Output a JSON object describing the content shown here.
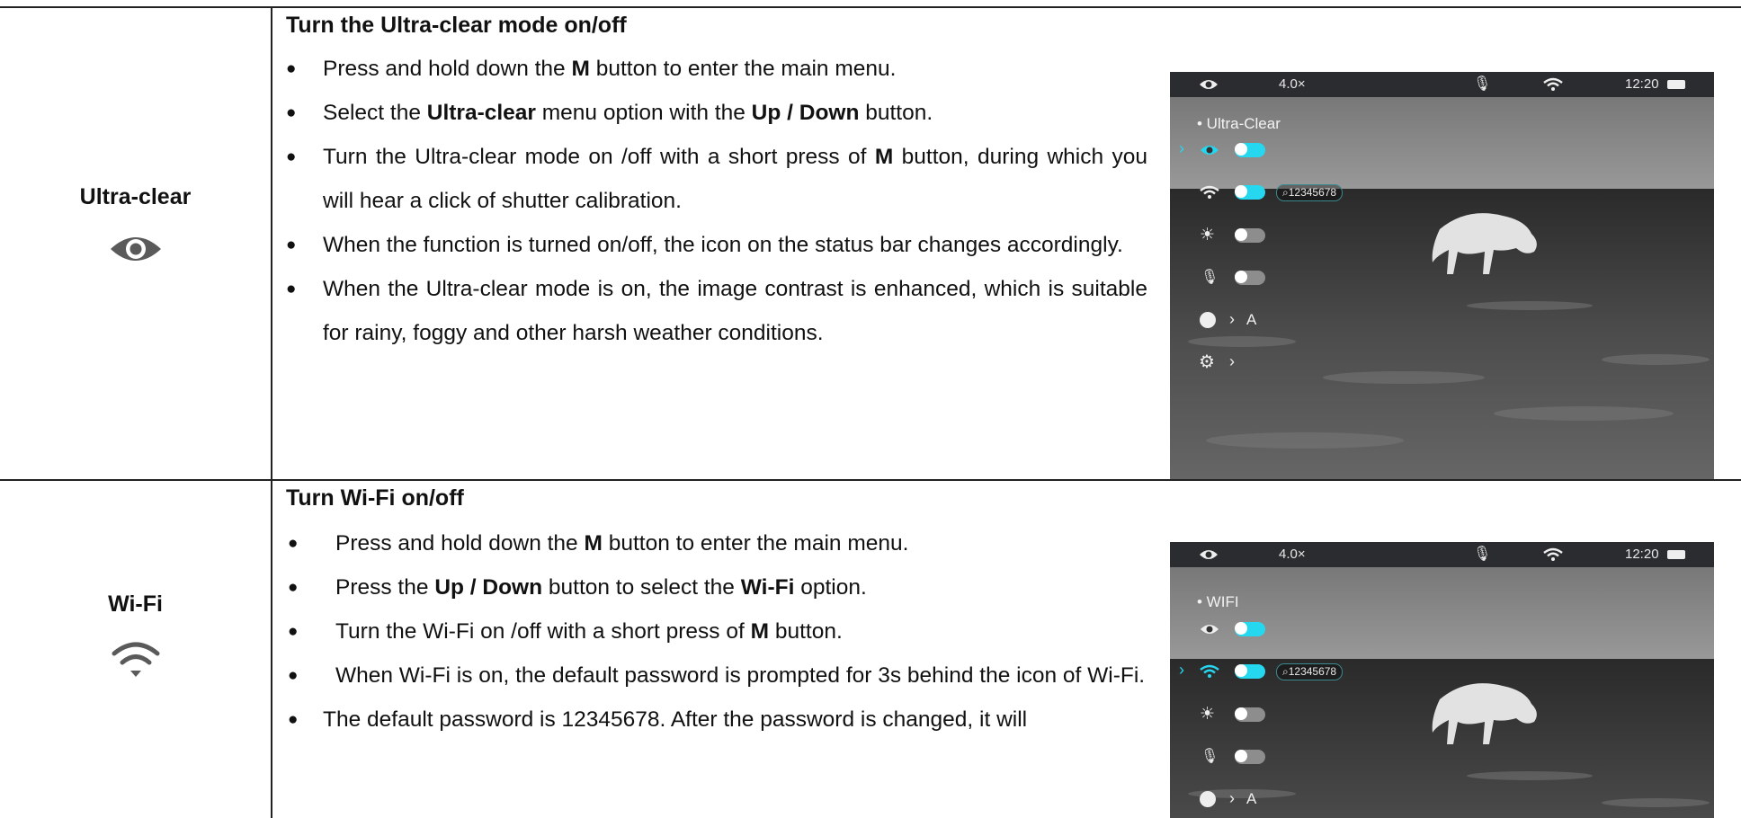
{
  "sections": [
    {
      "label": "Ultra-clear",
      "icon": "eye-icon",
      "heading": "Turn the Ultra-clear mode on/off",
      "bullets": [
        {
          "parts": [
            [
              "Press and hold down the ",
              false
            ],
            [
              "M",
              true
            ],
            [
              " button to enter the main menu.",
              false
            ]
          ]
        },
        {
          "parts": [
            [
              "Select the ",
              false
            ],
            [
              "Ultra-clear",
              true
            ],
            [
              " menu option with the ",
              false
            ],
            [
              "Up / Down",
              true
            ],
            [
              " button.",
              false
            ]
          ]
        },
        {
          "parts": [
            [
              "Turn the Ultra-clear mode on /off with a short press of ",
              false
            ],
            [
              "M",
              true
            ],
            [
              " button, during which you will hear a click of shutter calibration.",
              false
            ]
          ]
        },
        {
          "parts": [
            [
              "When the function is turned on/off, the icon on the status bar changes accordingly.",
              false
            ]
          ]
        },
        {
          "parts": [
            [
              "When the Ultra-clear mode is on, the image contrast is enhanced, which is suitable for rainy, foggy and other harsh weather conditions.",
              false
            ]
          ]
        }
      ],
      "screen": {
        "menu_title": "• Ultra-Clear",
        "zoom": "4.0×",
        "time": "12:20",
        "password_badge": "⌕12345678",
        "palette_value": "A"
      }
    },
    {
      "label": "Wi-Fi",
      "icon": "wifi-icon",
      "heading": "Turn Wi-Fi on/off",
      "bullets": [
        {
          "parts": [
            [
              "Press and hold down the ",
              false
            ],
            [
              "M",
              true
            ],
            [
              " button to enter the main menu.",
              false
            ]
          ]
        },
        {
          "parts": [
            [
              "Press the ",
              false
            ],
            [
              "Up / Down",
              true
            ],
            [
              " button to select the ",
              false
            ],
            [
              "Wi-Fi",
              true
            ],
            [
              " option.",
              false
            ]
          ]
        },
        {
          "parts": [
            [
              "Turn the Wi-Fi on /off with a short press of ",
              false
            ],
            [
              "M",
              true
            ],
            [
              " button.",
              false
            ]
          ]
        },
        {
          "parts": [
            [
              "When Wi-Fi is on, the default password is prompted for 3s behind the icon of Wi-Fi.",
              false
            ]
          ]
        },
        {
          "parts": [
            [
              "The default password is 12345678. After the password is changed, it will",
              false
            ]
          ]
        }
      ],
      "screen": {
        "menu_title": "• WIFI",
        "zoom": "4.0×",
        "time": "12:20",
        "password_badge": "⌕12345678",
        "palette_value": "A"
      }
    }
  ],
  "colors": {
    "accent": "#25d8ef",
    "rule": "#222222",
    "icon_gray": "#5a5a5a"
  }
}
